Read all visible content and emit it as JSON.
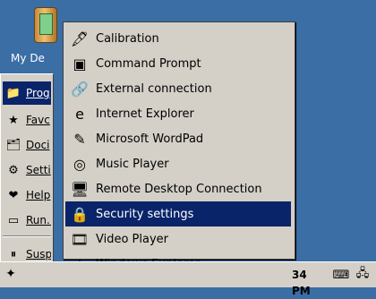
{
  "desktop": {
    "icon_label": "My De",
    "background": "#3a6ea5"
  },
  "start_menu": {
    "items": [
      {
        "label": "Prog",
        "icon": "programs-icon"
      },
      {
        "label": "Favc",
        "icon": "favorites-star-icon"
      },
      {
        "label": "Doci",
        "icon": "documents-icon"
      },
      {
        "label": "Setti",
        "icon": "settings-icon"
      },
      {
        "label": "Help",
        "icon": "help-icon"
      },
      {
        "label": "Run..",
        "icon": "run-icon"
      },
      {
        "label": "Susp",
        "icon": "suspend-icon"
      }
    ]
  },
  "programs_submenu": {
    "items": [
      {
        "label": "Calibration",
        "icon": "calibration-icon"
      },
      {
        "label": "Command Prompt",
        "icon": "command-prompt-icon"
      },
      {
        "label": "External connection",
        "icon": "external-connection-icon"
      },
      {
        "label": "Internet Explorer",
        "icon": "internet-explorer-icon"
      },
      {
        "label": "Microsoft WordPad",
        "icon": "wordpad-icon"
      },
      {
        "label": "Music Player",
        "icon": "music-player-icon"
      },
      {
        "label": "Remote Desktop Connection",
        "icon": "remote-desktop-icon"
      },
      {
        "label": "Security settings",
        "icon": "security-lock-icon"
      },
      {
        "label": "Video Player",
        "icon": "video-player-icon"
      },
      {
        "label": "Windows Explorer",
        "icon": "windows-explorer-icon"
      }
    ],
    "selected_index": 7,
    "selection_color": "#0a246a"
  },
  "taskbar": {
    "clock": "34 PM",
    "tray_icons": [
      "tray-keyboard-icon",
      "tray-network-icon"
    ]
  }
}
